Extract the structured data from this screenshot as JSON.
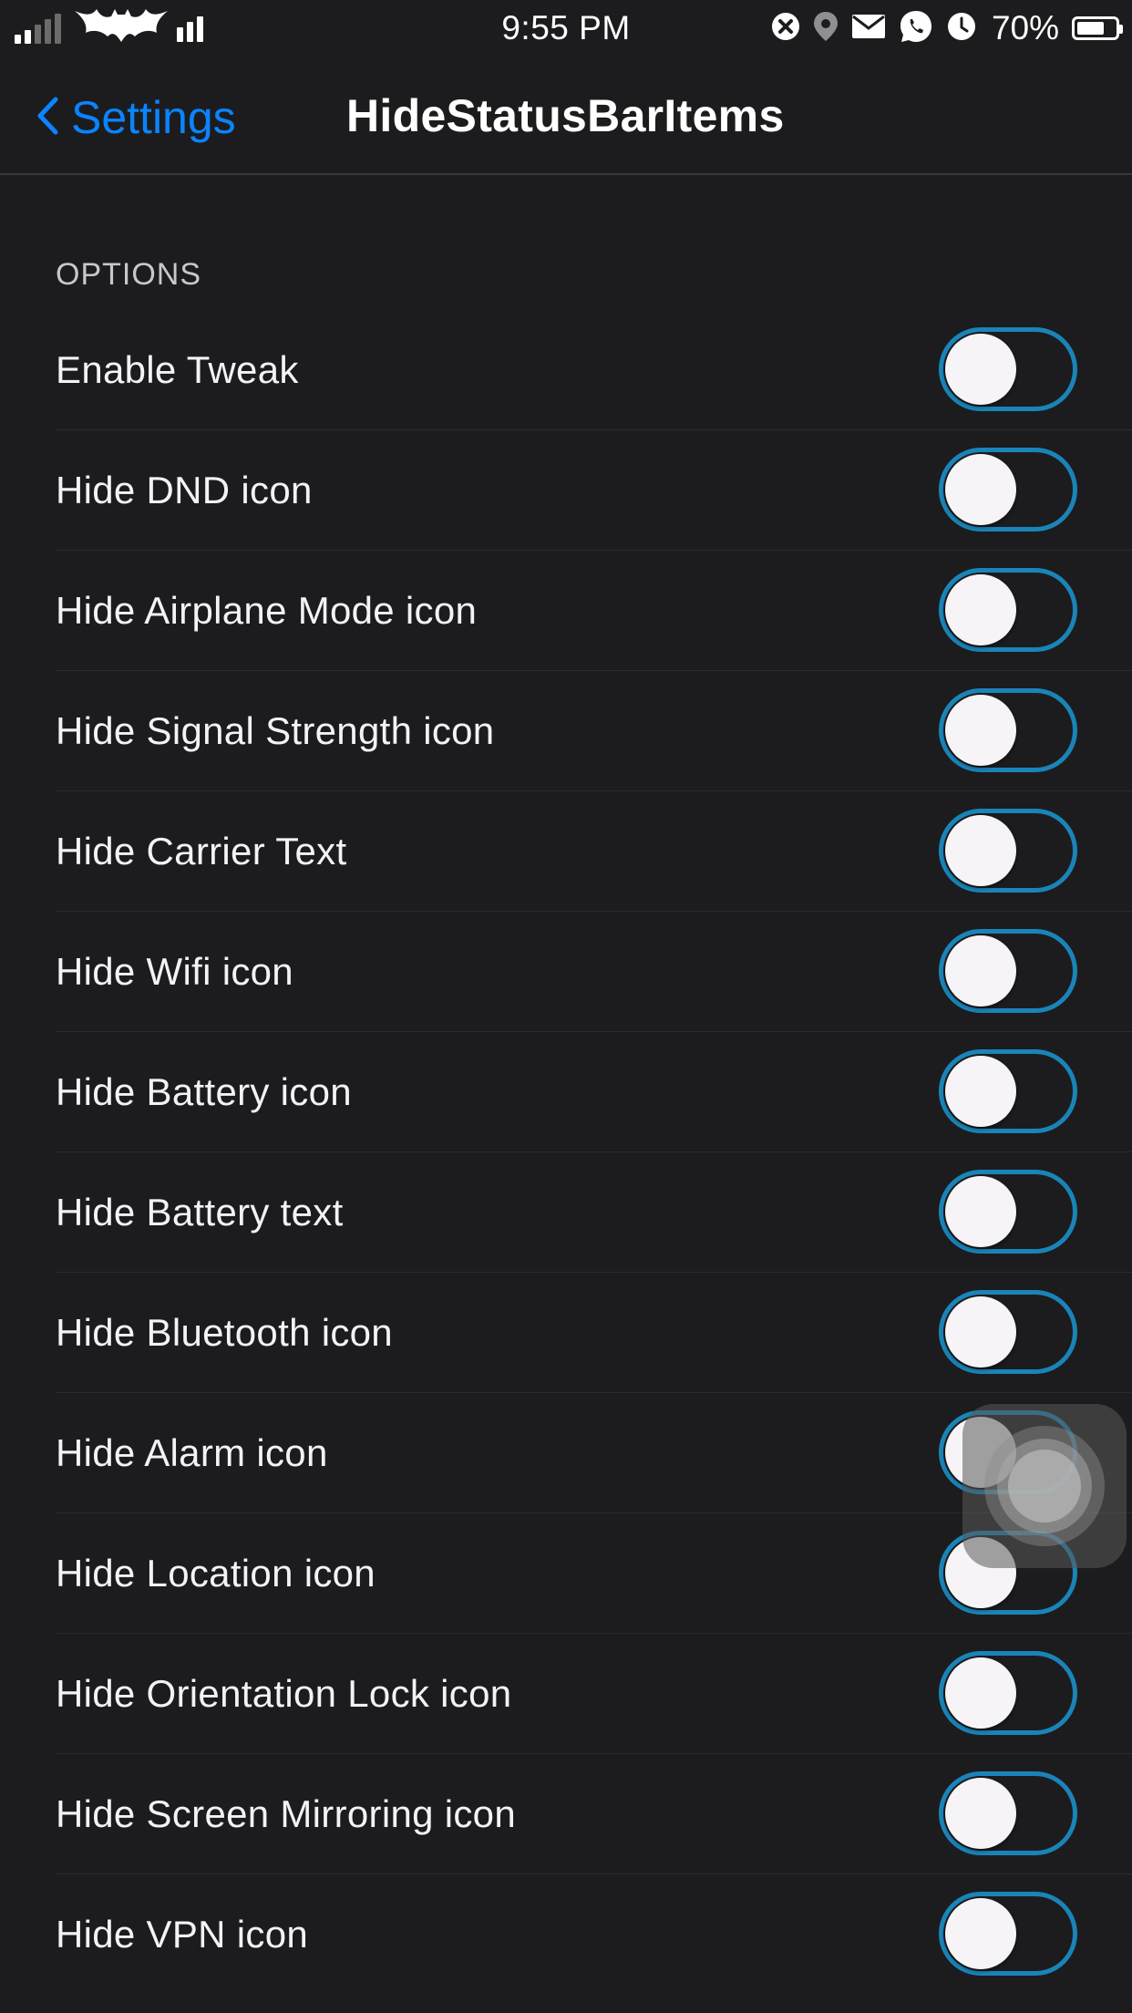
{
  "status_bar": {
    "time": "9:55 PM",
    "battery_percent": "70%",
    "icons": [
      "cellular-signal-icon",
      "batman-logo-icon",
      "wifi-bars-icon",
      "close-circle-icon",
      "location-icon",
      "mail-icon",
      "whatsapp-icon",
      "alarm-clock-icon",
      "battery-icon"
    ]
  },
  "nav": {
    "back_label": "Settings",
    "title": "HideStatusBarItems"
  },
  "section": {
    "header": "OPTIONS"
  },
  "options": [
    {
      "label": "Enable Tweak",
      "on": false
    },
    {
      "label": "Hide DND icon",
      "on": false
    },
    {
      "label": "Hide Airplane Mode icon",
      "on": false
    },
    {
      "label": "Hide Signal Strength icon",
      "on": false
    },
    {
      "label": "Hide Carrier Text",
      "on": false
    },
    {
      "label": "Hide Wifi icon",
      "on": false
    },
    {
      "label": "Hide Battery icon",
      "on": false
    },
    {
      "label": "Hide Battery text",
      "on": false
    },
    {
      "label": "Hide Bluetooth icon",
      "on": false
    },
    {
      "label": "Hide Alarm icon",
      "on": false
    },
    {
      "label": "Hide Location icon",
      "on": false
    },
    {
      "label": "Hide Orientation Lock icon",
      "on": false
    },
    {
      "label": "Hide Screen Mirroring icon",
      "on": false
    },
    {
      "label": "Hide VPN icon",
      "on": false
    }
  ],
  "colors": {
    "background": "#1c1c1e",
    "accent": "#0a84ff",
    "toggle_border": "#1a84b8",
    "knob": "#f6f4f6"
  }
}
